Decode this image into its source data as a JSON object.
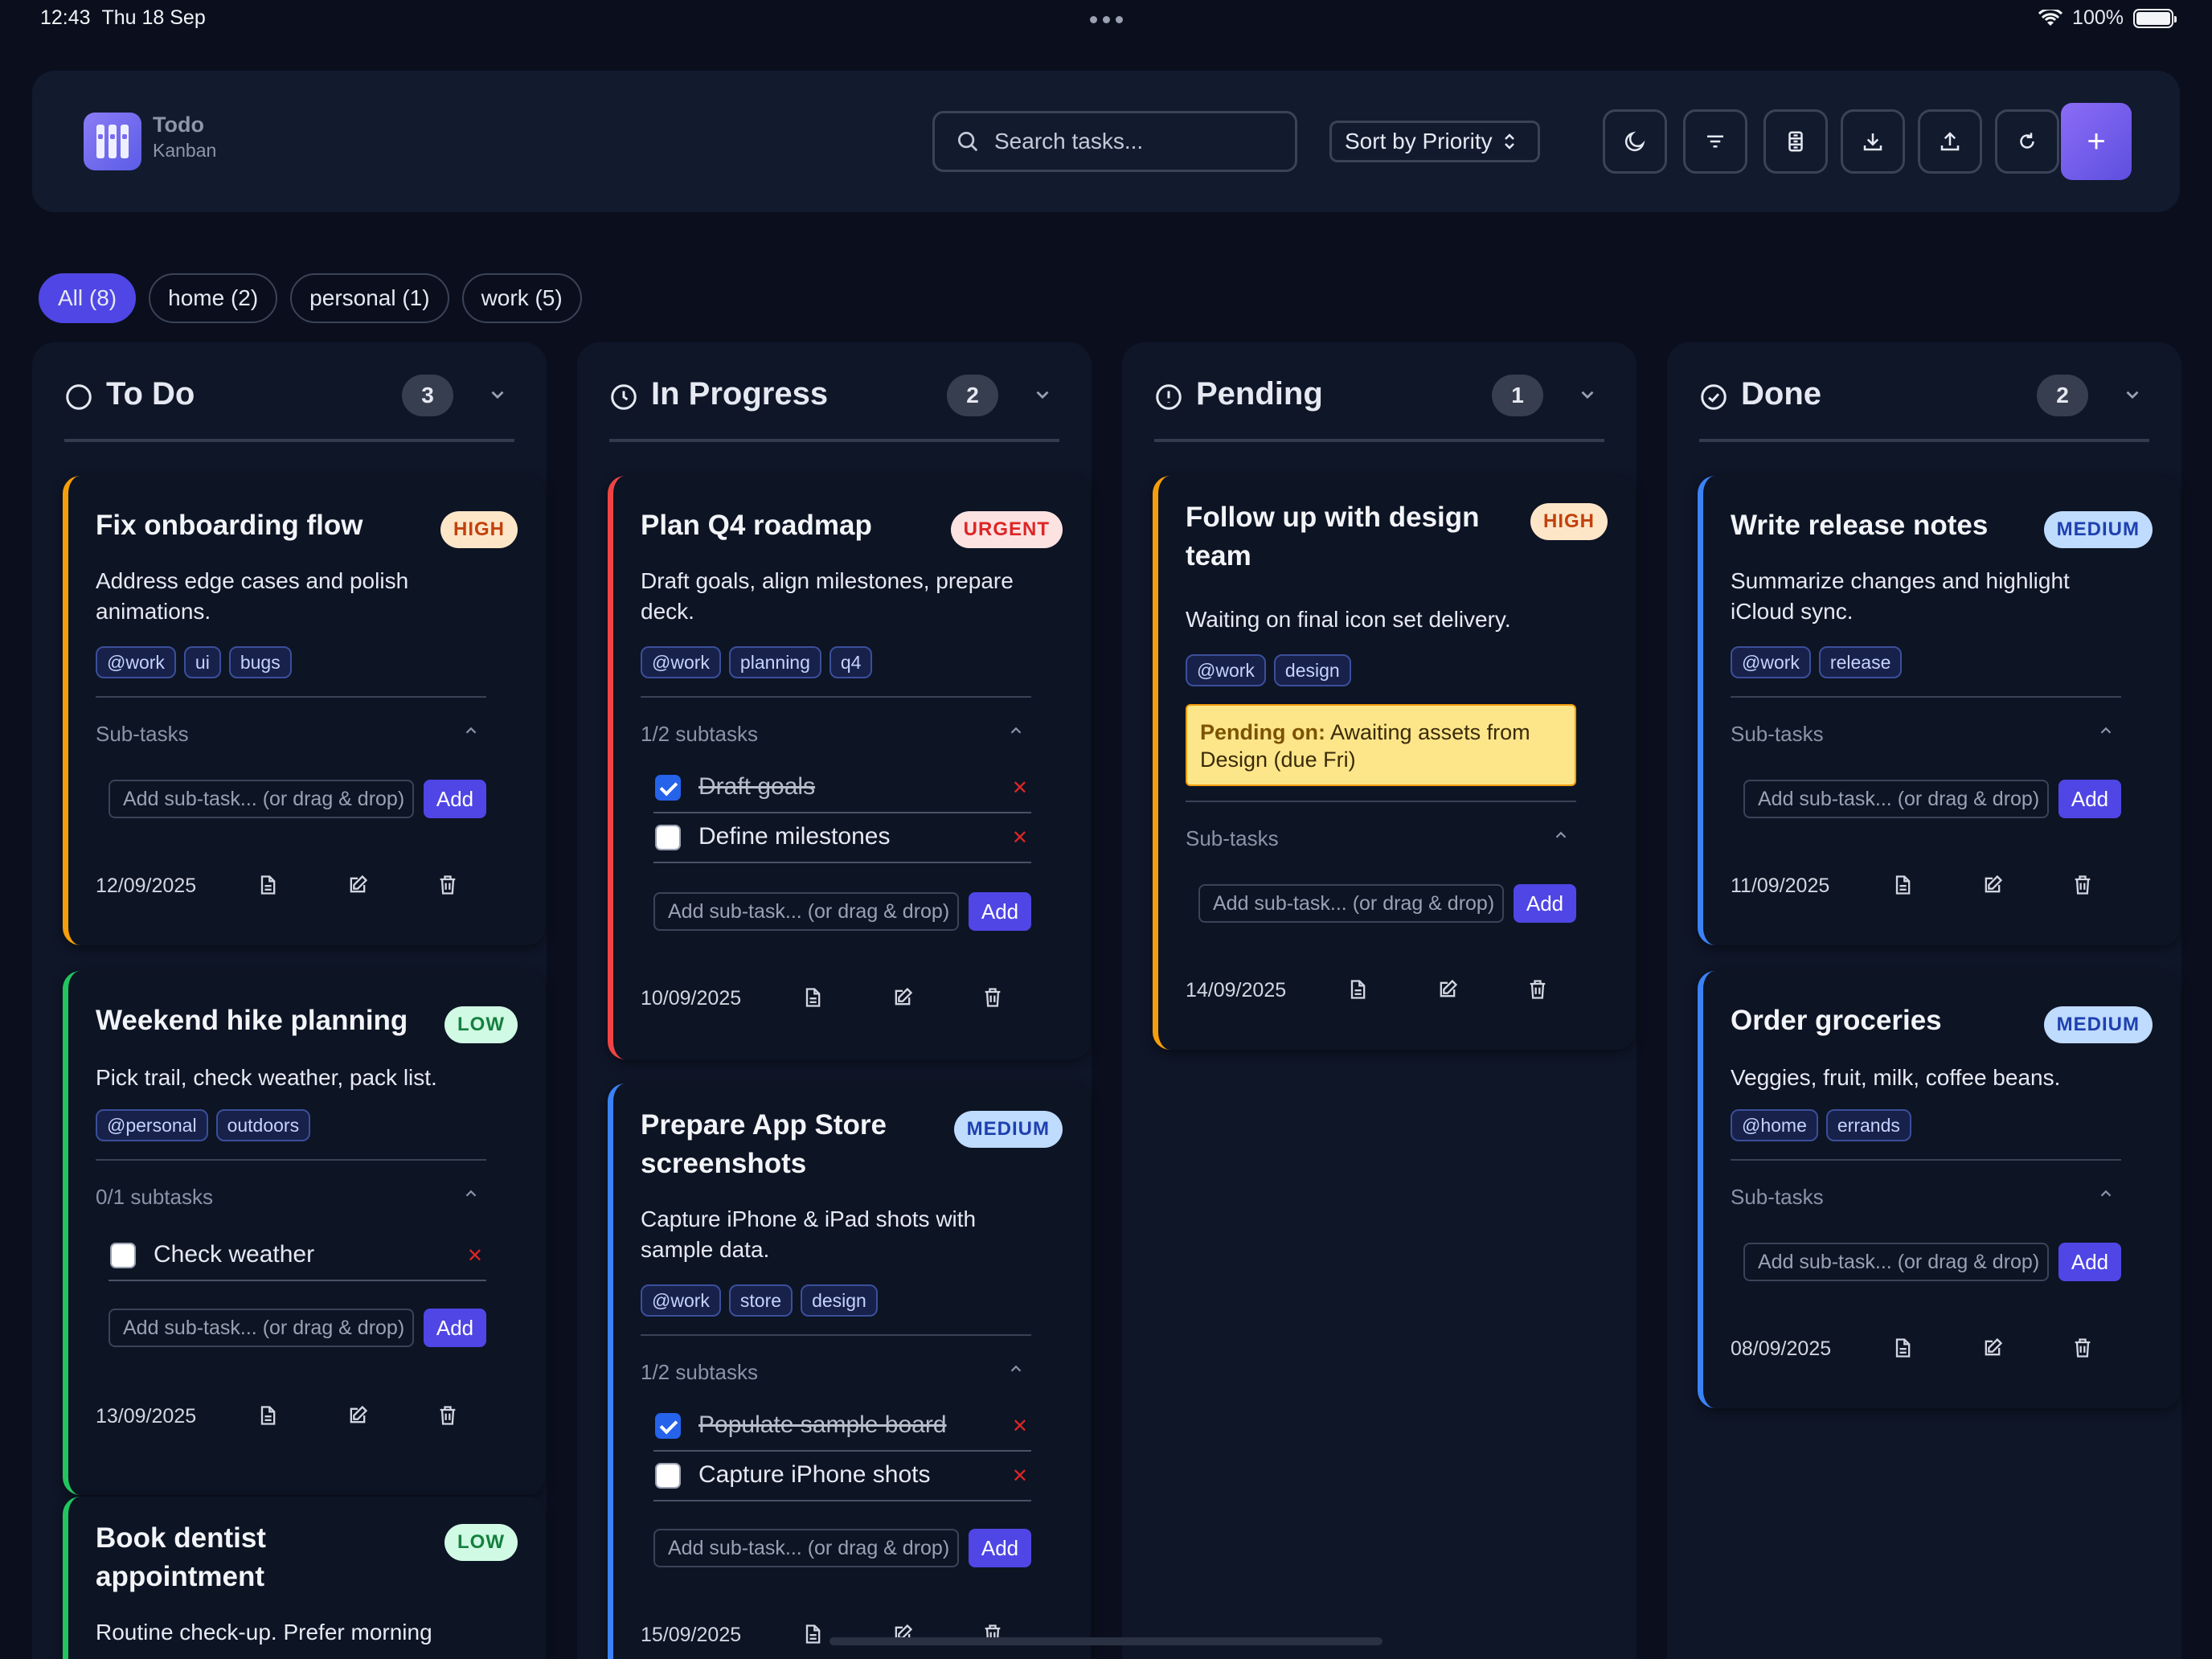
{
  "status_bar": {
    "time": "12:43",
    "date": "Thu 18 Sep",
    "battery": "100%"
  },
  "app": {
    "title": "Todo",
    "subtitle": "Kanban"
  },
  "toolbar": {
    "search_placeholder": "Search tasks...",
    "sort_label": "Sort by Priority",
    "buttons": [
      "moon-icon",
      "filter-icon",
      "archive-icon",
      "download-icon",
      "upload-icon",
      "refresh-icon"
    ],
    "add_label": "+"
  },
  "filters": [
    {
      "label": "All (8)",
      "active": true
    },
    {
      "label": "home (2)",
      "active": false
    },
    {
      "label": "personal (1)",
      "active": false
    },
    {
      "label": "work (5)",
      "active": false
    }
  ],
  "colors": {
    "high": "#f59e0b",
    "urgent": "#ef4444",
    "low": "#22c55e",
    "medium": "#3b82f6",
    "accent": "#4f46e5"
  },
  "columns": [
    {
      "title": "To Do",
      "count": "3",
      "cards": [
        {
          "title": "Fix onboarding flow",
          "priority": "HIGH",
          "description": "Address edge cases and polish animations.",
          "tags": [
            "@work",
            "ui",
            "bugs"
          ],
          "subtasks_label": "Sub-tasks",
          "subtasks": [],
          "add_placeholder": "Add sub-task... (or drag & drop)",
          "add_label": "Add",
          "date": "12/09/2025"
        },
        {
          "title": "Weekend hike planning",
          "priority": "LOW",
          "description": "Pick trail, check weather, pack list.",
          "tags": [
            "@personal",
            "outdoors"
          ],
          "subtasks_label": "0/1 subtasks",
          "subtasks": [
            {
              "text": "Check weather",
              "done": false
            }
          ],
          "add_placeholder": "Add sub-task... (or drag & drop)",
          "add_label": "Add",
          "date": "13/09/2025"
        },
        {
          "title": "Book dentist appointment",
          "priority": "LOW",
          "description": "Routine check-up. Prefer morning"
        }
      ]
    },
    {
      "title": "In Progress",
      "count": "2",
      "cards": [
        {
          "title": "Plan Q4 roadmap",
          "priority": "URGENT",
          "description": "Draft goals, align milestones, prepare deck.",
          "tags": [
            "@work",
            "planning",
            "q4"
          ],
          "subtasks_label": "1/2 subtasks",
          "subtasks": [
            {
              "text": "Draft goals",
              "done": true
            },
            {
              "text": "Define milestones",
              "done": false
            }
          ],
          "add_placeholder": "Add sub-task... (or drag & drop)",
          "add_label": "Add",
          "date": "10/09/2025"
        },
        {
          "title": "Prepare App Store screenshots",
          "priority": "MEDIUM",
          "description": "Capture iPhone & iPad shots with sample data.",
          "tags": [
            "@work",
            "store",
            "design"
          ],
          "subtasks_label": "1/2 subtasks",
          "subtasks": [
            {
              "text": "Populate sample board",
              "done": true
            },
            {
              "text": "Capture iPhone shots",
              "done": false
            }
          ],
          "add_placeholder": "Add sub-task... (or drag & drop)",
          "add_label": "Add",
          "date": "15/09/2025"
        }
      ]
    },
    {
      "title": "Pending",
      "count": "1",
      "cards": [
        {
          "title": "Follow up with design team",
          "priority": "HIGH",
          "description": "Waiting on final icon set delivery.",
          "tags": [
            "@work",
            "design"
          ],
          "pending_label": "Pending on:",
          "pending_text": "Awaiting assets from Design (due Fri)",
          "subtasks_label": "Sub-tasks",
          "subtasks": [],
          "add_placeholder": "Add sub-task... (or drag & drop)",
          "add_label": "Add",
          "date": "14/09/2025"
        }
      ]
    },
    {
      "title": "Done",
      "count": "2",
      "cards": [
        {
          "title": "Write release notes",
          "priority": "MEDIUM",
          "description": "Summarize changes and highlight iCloud sync.",
          "tags": [
            "@work",
            "release"
          ],
          "subtasks_label": "Sub-tasks",
          "subtasks": [],
          "add_placeholder": "Add sub-task... (or drag & drop)",
          "add_label": "Add",
          "date": "11/09/2025"
        },
        {
          "title": "Order groceries",
          "priority": "MEDIUM",
          "description": "Veggies, fruit, milk, coffee beans.",
          "tags": [
            "@home",
            "errands"
          ],
          "subtasks_label": "Sub-tasks",
          "subtasks": [],
          "add_placeholder": "Add sub-task... (or drag & drop)",
          "add_label": "Add",
          "date": "08/09/2025"
        }
      ]
    }
  ]
}
